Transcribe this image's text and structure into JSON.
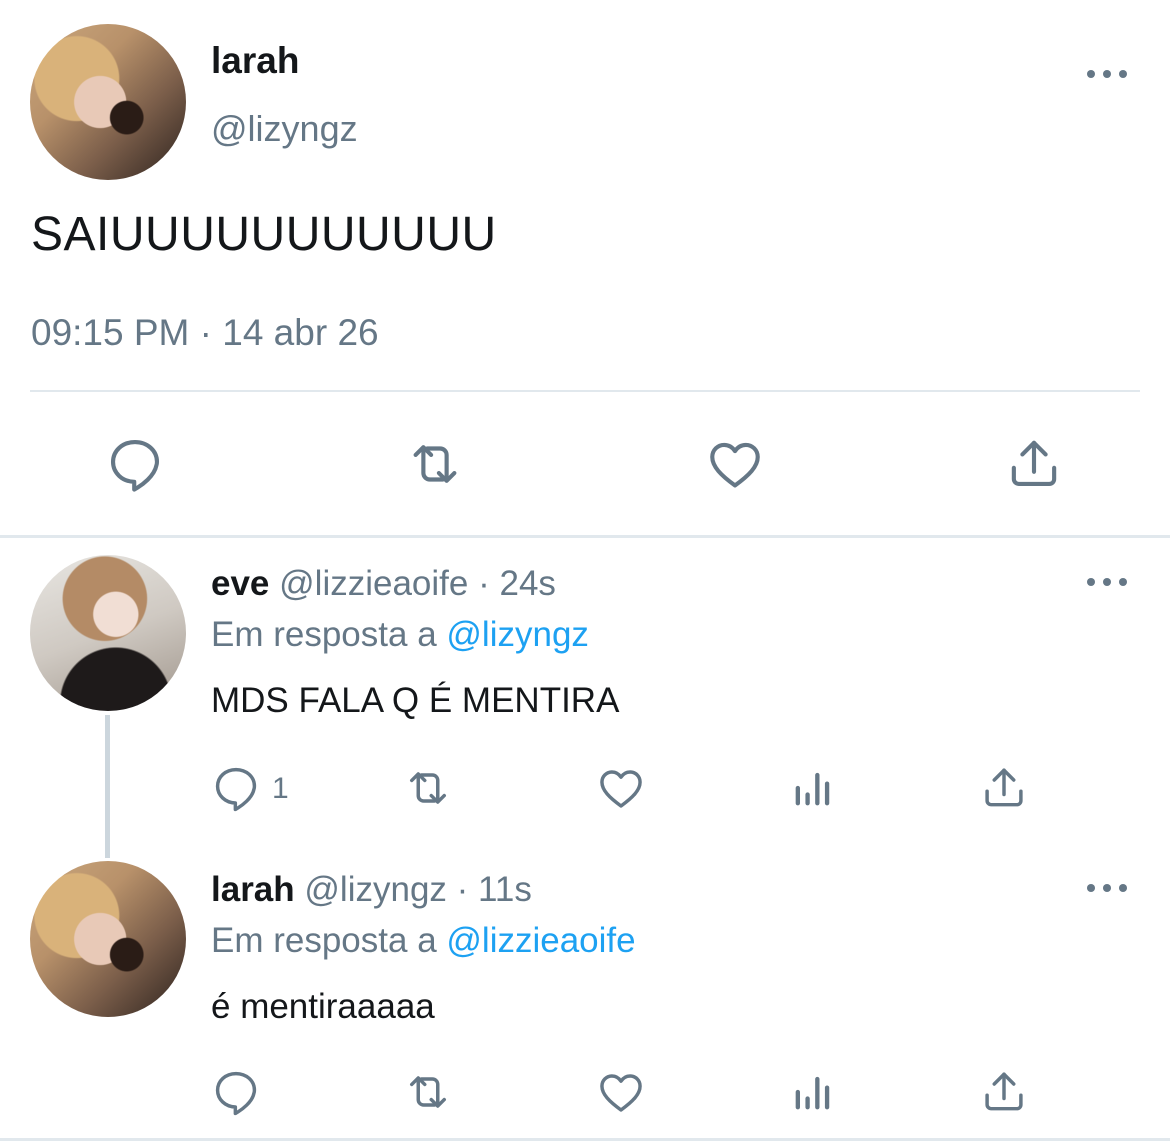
{
  "main_tweet": {
    "display_name": "larah",
    "handle": "@lizyngz",
    "text": "SAIUUUUUUUUUUU",
    "timestamp": "09:15 PM · 14 abr 26"
  },
  "replies": [
    {
      "display_name": "eve",
      "handle": "@lizzieaoife",
      "time": "· 24s",
      "reply_prefix": "Em resposta a",
      "reply_to": "@lizyngz",
      "text": "MDS FALA Q É MENTIRA",
      "reply_count": "1"
    },
    {
      "display_name": "larah",
      "handle": "@lizyngz",
      "time": "· 11s",
      "reply_prefix": "Em resposta a",
      "reply_to": "@lizzieaoife",
      "text": "é mentiraaaaa",
      "reply_count": ""
    }
  ],
  "icons": {
    "more": "more-horizontal-icon",
    "reply": "reply-icon",
    "retweet": "retweet-icon",
    "like": "like-icon",
    "share": "share-icon",
    "analytics": "analytics-icon"
  },
  "colors": {
    "text": "#14171a",
    "muted": "#657786",
    "link": "#1da1f2",
    "divider": "#e1e8ed"
  }
}
